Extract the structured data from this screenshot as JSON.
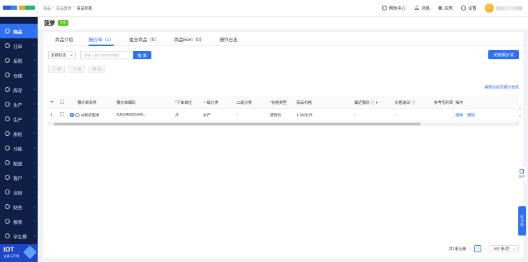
{
  "sidebar": {
    "items": [
      {
        "label": "商品",
        "active": true
      },
      {
        "label": "订单"
      },
      {
        "label": "采购"
      },
      {
        "label": "仓储"
      },
      {
        "label": "库存"
      },
      {
        "label": "生产"
      },
      {
        "label": "生产"
      },
      {
        "label": "质检"
      },
      {
        "label": "分拣"
      },
      {
        "label": "配送"
      },
      {
        "label": "客户"
      },
      {
        "label": "业财"
      },
      {
        "label": "财务"
      },
      {
        "label": "报表"
      },
      {
        "label": "学生餐"
      }
    ],
    "iot": {
      "title": "IOT",
      "subtitle": "设备与环境"
    }
  },
  "breadcrumb": {
    "c1": "商品",
    "c2": "商品管理",
    "c3": "商品列表"
  },
  "top": {
    "help": "帮助中心",
    "messages": "消息",
    "apps": "应用",
    "settings": "设置"
  },
  "page": {
    "title": "菠萝",
    "badge": "在售"
  },
  "tabs": [
    "商品介绍",
    "报价单（1）",
    "组合商品（0）",
    "商品Bom（0）",
    "操作日志"
  ],
  "filter": {
    "status": "全部状态",
    "search_placeholder": "请输入报价单名称/编码",
    "search_btn": "搜 索",
    "link_btn": "关联报价单"
  },
  "bulk": {
    "up": "上 架",
    "down": "下 架",
    "del": "删 除"
  },
  "edit_link": "编辑当前页报价信息",
  "table": {
    "headers": {
      "name": "报价单名称",
      "code": "报价单编码",
      "unit": "*下单单位",
      "cat1": "一级分类",
      "cat2": "二级分类",
      "ptype": "*价格类型",
      "price": "商品价格",
      "last": "最近报价",
      "fluc": "价格波动",
      "margin": "参考毛利率",
      "op": "操作"
    },
    "rows": [
      {
        "idx": "1",
        "name": "ai测试使用",
        "code": "BJD240925000...",
        "unit": "斤",
        "cat1": "水产",
        "cat2": "-",
        "ptype": "按时价",
        "price": "1.00元/斤",
        "last": "-",
        "fluc": "-",
        "margin": "",
        "edit": "编辑",
        "del": "删除"
      }
    ]
  },
  "pager": {
    "total": "共1条记录",
    "page": "1",
    "size": "100 条/页"
  },
  "float": {
    "task": "任务",
    "new": "新功能"
  }
}
